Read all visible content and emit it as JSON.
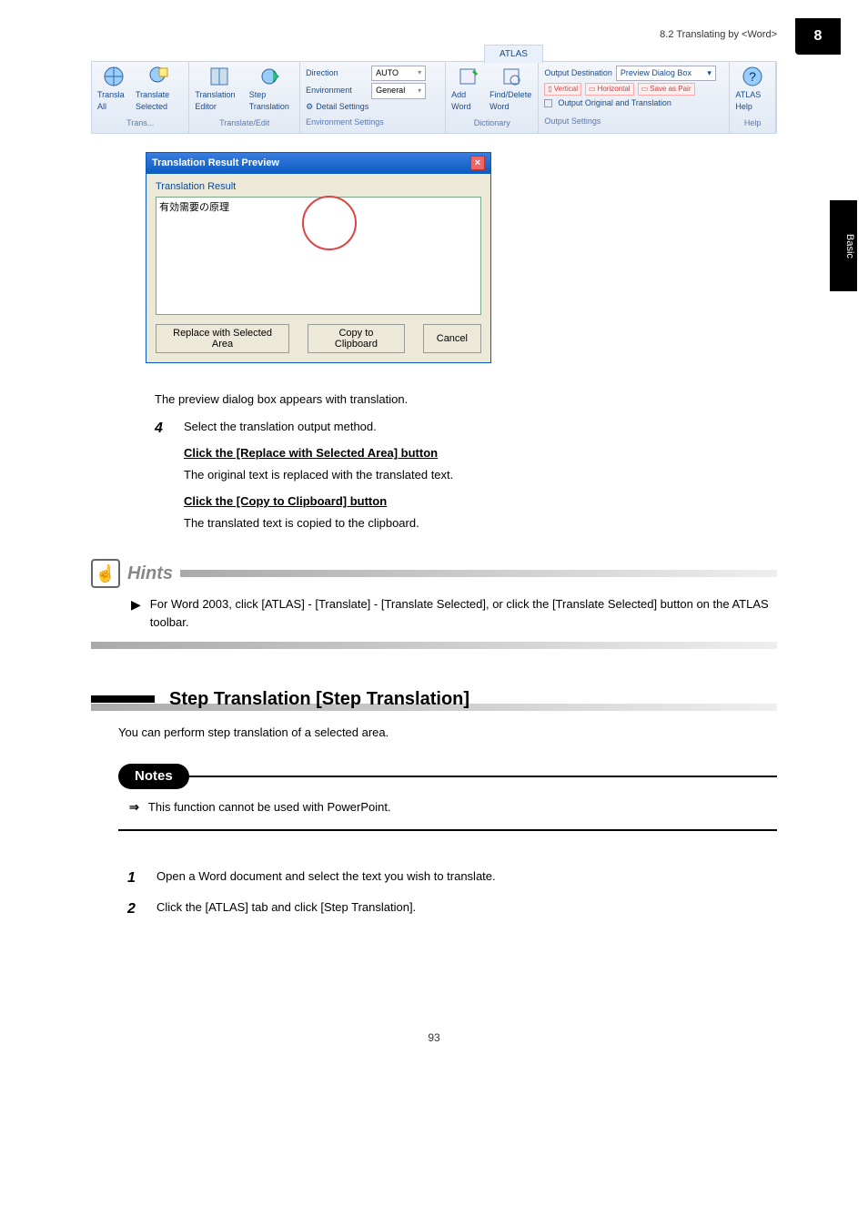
{
  "page_header": {
    "section": "8.2 Translating by <Word>",
    "chapter_num": "8",
    "side_label": "Basic"
  },
  "ribbon": {
    "tab": "ATLAS",
    "trans": {
      "all": "Transla All",
      "selected": "Translate Selected",
      "group": "Trans..."
    },
    "edit": {
      "editor": "Translation Editor",
      "step": "Step Translation",
      "group": "Translate/Edit"
    },
    "env": {
      "direction_label": "Direction",
      "direction_value": "AUTO",
      "environment_label": "Environment",
      "environment_value": "General",
      "detail": "Detail Settings",
      "group": "Environment Settings"
    },
    "dict": {
      "add": "Add Word",
      "find": "Find/Delete Word",
      "group": "Dictionary"
    },
    "output": {
      "dest_label": "Output Destination",
      "dest_value": "Preview Dialog Box",
      "vertical": "Vertical",
      "horizontal": "Horizontal",
      "save_pair": "Save as Pair",
      "orig_trans": "Output Original and Translation",
      "group": "Output Settings"
    },
    "help": {
      "label": "ATLAS Help",
      "group": "Help"
    }
  },
  "dialog": {
    "title": "Translation Result Preview",
    "label": "Translation Result",
    "content": "有効需要の原理",
    "replace": "Replace with Selected Area",
    "copy": "Copy to Clipboard",
    "cancel": "Cancel"
  },
  "body": {
    "preview_text": "The preview dialog box appears with translation.",
    "step4_num": "4",
    "step4_text": "Select the translation output method.",
    "replace_step": {
      "heading": "Click the [Replace with Selected Area] button",
      "text": "The original text is replaced with the translated text."
    },
    "copy_step": {
      "heading": "Click the [Copy to Clipboard] button",
      "text": "The translated text is copied to the clipboard."
    }
  },
  "hints": {
    "label": "Hints",
    "text": "For Word 2003, click [ATLAS] - [Translate] - [Translate Selected], or click the [Translate Selected] button on the ATLAS toolbar."
  },
  "section": {
    "title": "Step Translation [Step Translation]",
    "intro": "You can perform step translation of a selected area.",
    "note": "This function cannot be used with PowerPoint."
  },
  "steps": {
    "s1_num": "1",
    "s1_text": "Open a Word document and select the text you wish to translate.",
    "s2_num": "2",
    "s2_text": "Click the [ATLAS] tab and click [Step Translation]."
  },
  "notes_label": "Notes",
  "footer": "93"
}
